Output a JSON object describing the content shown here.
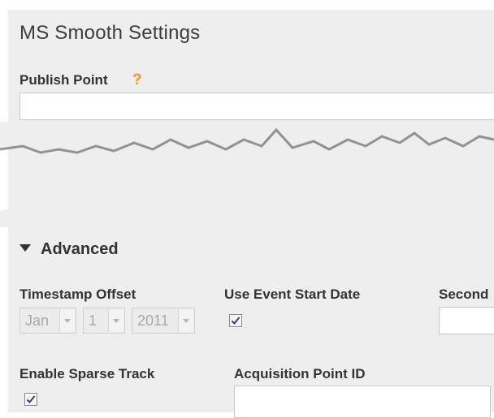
{
  "title": "MS Smooth Settings",
  "publish_point": {
    "label": "Publish Point",
    "help": "?",
    "value": ""
  },
  "advanced": {
    "label": "Advanced",
    "expanded": true
  },
  "timestamp_offset": {
    "label": "Timestamp Offset",
    "month": "Jan",
    "day": "1",
    "year": "2011",
    "disabled": true
  },
  "use_event_start_date": {
    "label": "Use Event Start Date",
    "checked": true
  },
  "seconds": {
    "label": "Second",
    "value": ""
  },
  "enable_sparse_track": {
    "label": "Enable Sparse Track",
    "checked": true
  },
  "acquisition_point_id": {
    "label": "Acquisition Point ID",
    "value": ""
  },
  "colors": {
    "panel": "#eeeeee",
    "help_accent": "#f7941d",
    "checkmark": "#2b3f8c"
  }
}
